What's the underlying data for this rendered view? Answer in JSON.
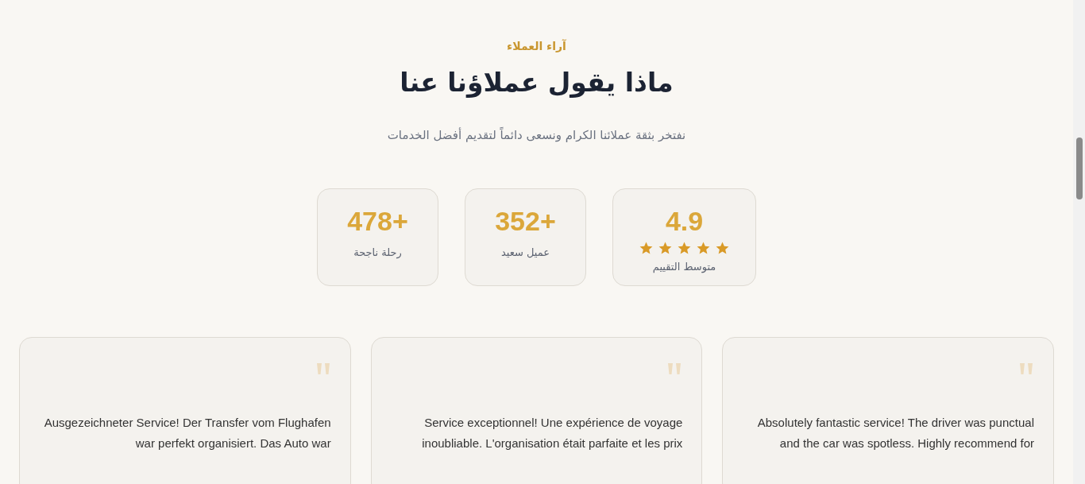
{
  "section": {
    "eyebrow": "آراء العملاء",
    "title": "ماذا يقول عملاؤنا عنا",
    "subtitle": "نفتخر بثقة عملائنا الكرام ونسعى دائماً لتقديم أفضل الخدمات"
  },
  "stats": [
    {
      "kind": "rating",
      "value": "4.9",
      "stars": 5,
      "label": "متوسط التقييم"
    },
    {
      "kind": "count",
      "value": "352+",
      "label": "عميل سعيد"
    },
    {
      "kind": "count",
      "value": "478+",
      "label": "رحلة ناجحة"
    }
  ],
  "testimonials": [
    {
      "text": "Absolutely fantastic service! The driver was punctual and the car was spotless. Highly recommend for"
    },
    {
      "text": "Service exceptionnel! Une expérience de voyage inoubliable. L'organisation était parfaite et les prix"
    },
    {
      "text": "Ausgezeichneter Service! Der Transfer vom Flughafen war perfekt organisiert. Das Auto war"
    }
  ]
}
